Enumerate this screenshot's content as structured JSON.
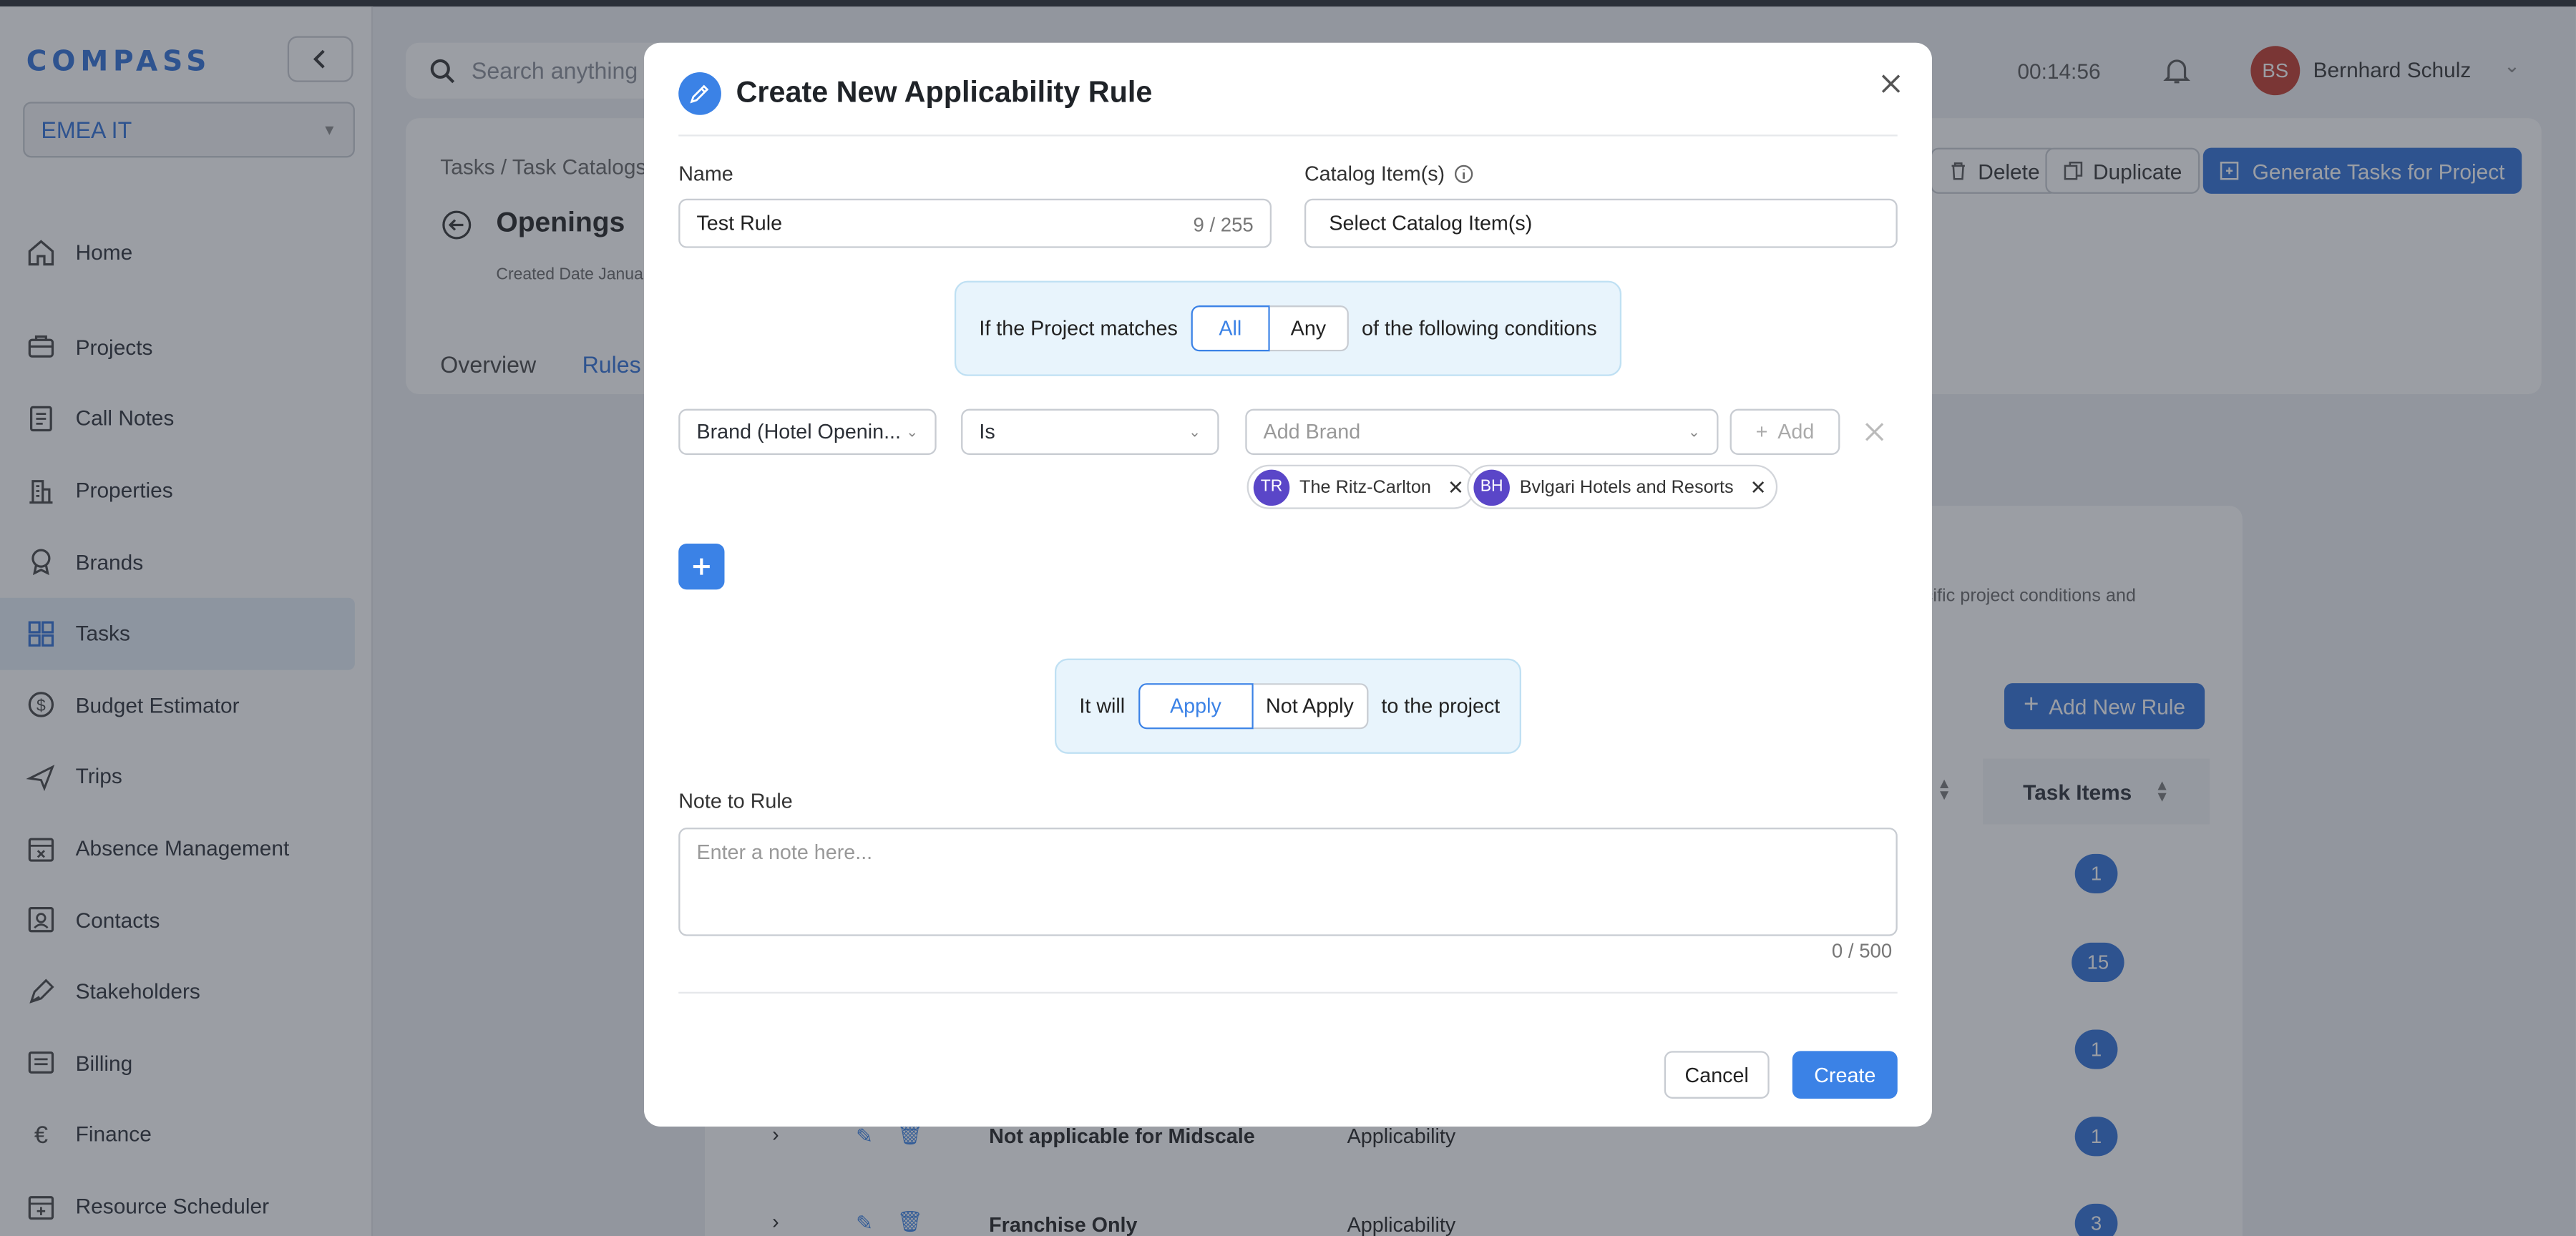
{
  "sidebar": {
    "logo": "COMPASS",
    "region": "EMEA IT",
    "items": [
      {
        "label": "Home",
        "icon": "home-icon"
      },
      {
        "label": "Projects",
        "icon": "briefcase-icon"
      },
      {
        "label": "Call Notes",
        "icon": "notes-icon"
      },
      {
        "label": "Properties",
        "icon": "building-icon"
      },
      {
        "label": "Brands",
        "icon": "badge-icon"
      },
      {
        "label": "Tasks",
        "icon": "grid-icon",
        "active": true
      },
      {
        "label": "Budget Estimator",
        "icon": "dollar-icon"
      },
      {
        "label": "Trips",
        "icon": "plane-icon"
      },
      {
        "label": "Absence Management",
        "icon": "calendar-x-icon"
      },
      {
        "label": "Contacts",
        "icon": "contact-icon"
      },
      {
        "label": "Stakeholders",
        "icon": "pen-icon"
      },
      {
        "label": "Billing",
        "icon": "billing-icon"
      },
      {
        "label": "Finance",
        "icon": "euro-icon"
      },
      {
        "label": "Resource Scheduler",
        "icon": "calendar-plus-icon"
      }
    ]
  },
  "header": {
    "search_placeholder": "Search anything",
    "timer": "00:14:56",
    "user_initials": "BS",
    "user_name": "Bernhard Schulz"
  },
  "background": {
    "breadcrumb": "Tasks  /  Task Catalogs",
    "title": "Openings",
    "created_label": "Created Date  Janua",
    "tabs": [
      "Overview",
      "Rules"
    ],
    "delete_label": "Delete",
    "duplicate_label": "Duplicate",
    "generate_label": "Generate Tasks for Project",
    "add_rule_label": "Add New Rule",
    "description_fragment": "ecific project conditions and",
    "task_items_header": "Task Items",
    "rows": [
      {
        "name": "",
        "type": "",
        "count": "1"
      },
      {
        "name": "",
        "type": "",
        "count": "15"
      },
      {
        "name": "",
        "type": "",
        "count": "1"
      },
      {
        "name": "Not applicable for Midscale",
        "type": "Applicability",
        "count": "1"
      },
      {
        "name": "Franchise Only",
        "type": "Applicability",
        "count": "3"
      }
    ]
  },
  "modal": {
    "title": "Create New Applicability Rule",
    "name_label": "Name",
    "name_value": "Test Rule",
    "name_counter": "9 / 255",
    "catalog_label": "Catalog Item(s)",
    "catalog_placeholder": "Select Catalog Item(s)",
    "match_prefix": "If the Project matches",
    "match_options": [
      "All",
      "Any"
    ],
    "match_selected": "All",
    "match_suffix": "of the following conditions",
    "condition": {
      "field": "Brand (Hotel Openin...",
      "operator": "Is",
      "value_placeholder": "Add Brand",
      "add_label": "Add",
      "chips": [
        {
          "initials": "TR",
          "label": "The Ritz-Carlton"
        },
        {
          "initials": "BH",
          "label": "Bvlgari Hotels and Resorts"
        }
      ]
    },
    "apply_prefix": "It will",
    "apply_options": [
      "Apply",
      "Not Apply"
    ],
    "apply_selected": "Apply",
    "apply_suffix": "to the project",
    "note_label": "Note to Rule",
    "note_placeholder": "Enter a note here...",
    "note_counter": "0 / 500",
    "cancel_label": "Cancel",
    "create_label": "Create"
  },
  "colors": {
    "accent": "#3b82e6",
    "brand": "#2f6fd6",
    "chip_avatar": "#5a46c8",
    "avatar": "#c0392b"
  }
}
